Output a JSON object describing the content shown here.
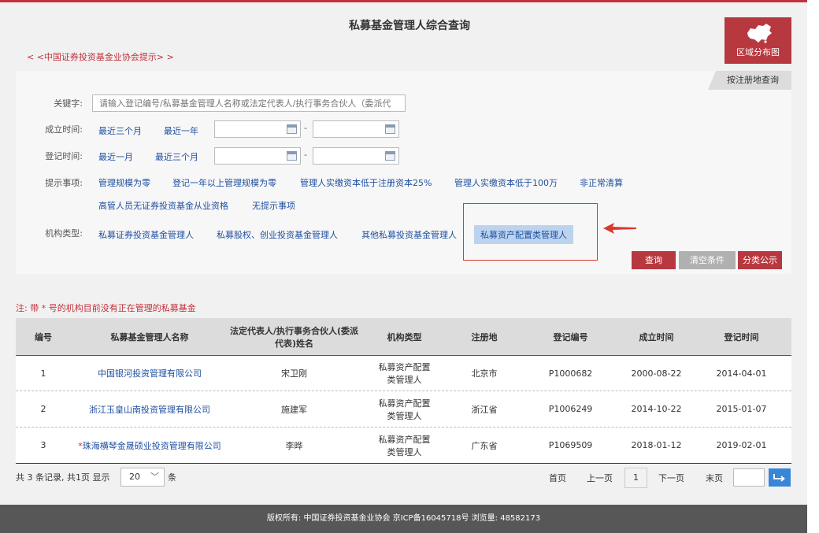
{
  "page": {
    "title": "私募基金管理人综合查询",
    "tip_link": "< <中国证券投资基金业协会提示> >",
    "region_button": "区域分布图",
    "region_tab": "按注册地查询"
  },
  "filters": {
    "keyword": {
      "label": "关键字:",
      "placeholder": "请输入登记编号/私募基金管理人名称或法定代表人/执行事务合伙人（委派代"
    },
    "established": {
      "label": "成立时间:",
      "options": [
        "最近三个月",
        "最近一年"
      ],
      "separator": "-"
    },
    "registered": {
      "label": "登记时间:",
      "options": [
        "最近一月",
        "最近三个月"
      ],
      "separator": "-"
    },
    "notes": {
      "label": "提示事项:",
      "options": [
        "管理规模为零",
        "登记一年以上管理规模为零",
        "管理人实缴资本低于注册资本25%",
        "管理人实缴资本低于100万",
        "非正常清算",
        "高管人员无证券投资基金从业资格",
        "无提示事项"
      ]
    },
    "org_type": {
      "label": "机构类型:",
      "options": [
        "私募证券投资基金管理人",
        "私募股权、创业投资基金管理人",
        "其他私募投资基金管理人",
        "私募资产配置类管理人"
      ],
      "selected": "私募资产配置类管理人"
    }
  },
  "buttons": {
    "query": "查询",
    "clear": "清空条件",
    "classify": "分类公示"
  },
  "note": "注: 带 * 号的机构目前没有正在管理的私募基金",
  "table": {
    "headers": [
      "编号",
      "私募基金管理人名称",
      "法定代表人/执行事务合伙人(委派代表)姓名",
      "机构类型",
      "注册地",
      "登记编号",
      "成立时间",
      "登记时间"
    ],
    "rows": [
      {
        "no": "1",
        "star": "",
        "name": "中国银河投资管理有限公司",
        "rep": "宋卫刚",
        "type": "私募资产配置类管理人",
        "place": "北京市",
        "code": "P1000682",
        "est": "2000-08-22",
        "reg": "2014-04-01"
      },
      {
        "no": "2",
        "star": "",
        "name": "浙江玉皇山南投资管理有限公司",
        "rep": "施建军",
        "type": "私募资产配置类管理人",
        "place": "浙江省",
        "code": "P1006249",
        "est": "2014-10-22",
        "reg": "2015-01-07"
      },
      {
        "no": "3",
        "star": "*",
        "name": "珠海横琴金晟硕业投资管理有限公司",
        "rep": "李晔",
        "type": "私募资产配置类管理人",
        "place": "广东省",
        "code": "P1069509",
        "est": "2018-01-12",
        "reg": "2019-02-01"
      }
    ]
  },
  "pager": {
    "summary": "共 3 条记录, 共1页  显示",
    "page_size": "20",
    "unit": "条",
    "first": "首页",
    "prev": "上一页",
    "current": "1",
    "next": "下一页",
    "last": "末页",
    "go_icon": "enter-arrow-icon"
  },
  "footer": "版权所有: 中国证券投资基金业协会 京ICP备16045718号   浏览量: 48582173",
  "colors": {
    "brand_red": "#b7383e",
    "link_blue": "#1f4fa0",
    "highlight_red": "#d9392f",
    "go_blue": "#3a86d6"
  }
}
